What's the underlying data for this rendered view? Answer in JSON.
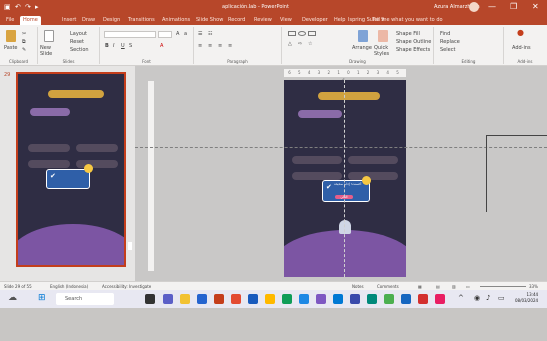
{
  "title_bar": {
    "document_name": "aplicación.lab - PowerPoint",
    "user_name": "Azura Almarzhyah",
    "minimize_glyph": "—",
    "restore_glyph": "❐",
    "close_glyph": "✕"
  },
  "menu": {
    "tabs": [
      "File",
      "Home",
      "Insert",
      "Draw",
      "Design",
      "Transitions",
      "Animations",
      "Slide Show",
      "Record",
      "Review",
      "View",
      "Developer",
      "Help",
      "Ispring Suite 9"
    ],
    "active_tab": "Home",
    "tell_me": "Tell me what you want to do"
  },
  "ribbon": {
    "groups": [
      "Clipboard",
      "Slides",
      "Font",
      "Paragraph",
      "Drawing",
      "Editing",
      "Add-ins"
    ],
    "buttons": {
      "paste": "Paste",
      "new_slide": "New Slide",
      "layout": "Layout",
      "reset": "Reset",
      "section": "Section",
      "arrange": "Arrange",
      "quick_styles": "Quick Styles",
      "shape_fill": "Shape Fill",
      "shape_outline": "Shape Outline",
      "shape_effects": "Shape Effects",
      "find": "Find",
      "replace": "Replace",
      "select": "Select",
      "add_ins": "Add-ins"
    }
  },
  "thumbnails": {
    "slide_number": "29"
  },
  "ruler": {
    "top_ticks": "6 5 4 3 2 1 0 1 2 3 4 5 6"
  },
  "slide": {
    "card_text": "أحسنت! إجابة صحيحة",
    "card_button": "التالي"
  },
  "status_bar": {
    "slide_count": "Slide 29 of 55",
    "language": "English (Indonesia)",
    "accessibility": "Accessibility: Investigate",
    "notes": "Notes",
    "comments": "Comments",
    "zoom": "33%"
  },
  "taskbar": {
    "search": "Search",
    "time": "13:44",
    "date": "08/03/2024"
  },
  "colors": {
    "accent": "#b7472a",
    "slide_background": "#2f2d44",
    "card_blue": "#2f5fa8"
  }
}
